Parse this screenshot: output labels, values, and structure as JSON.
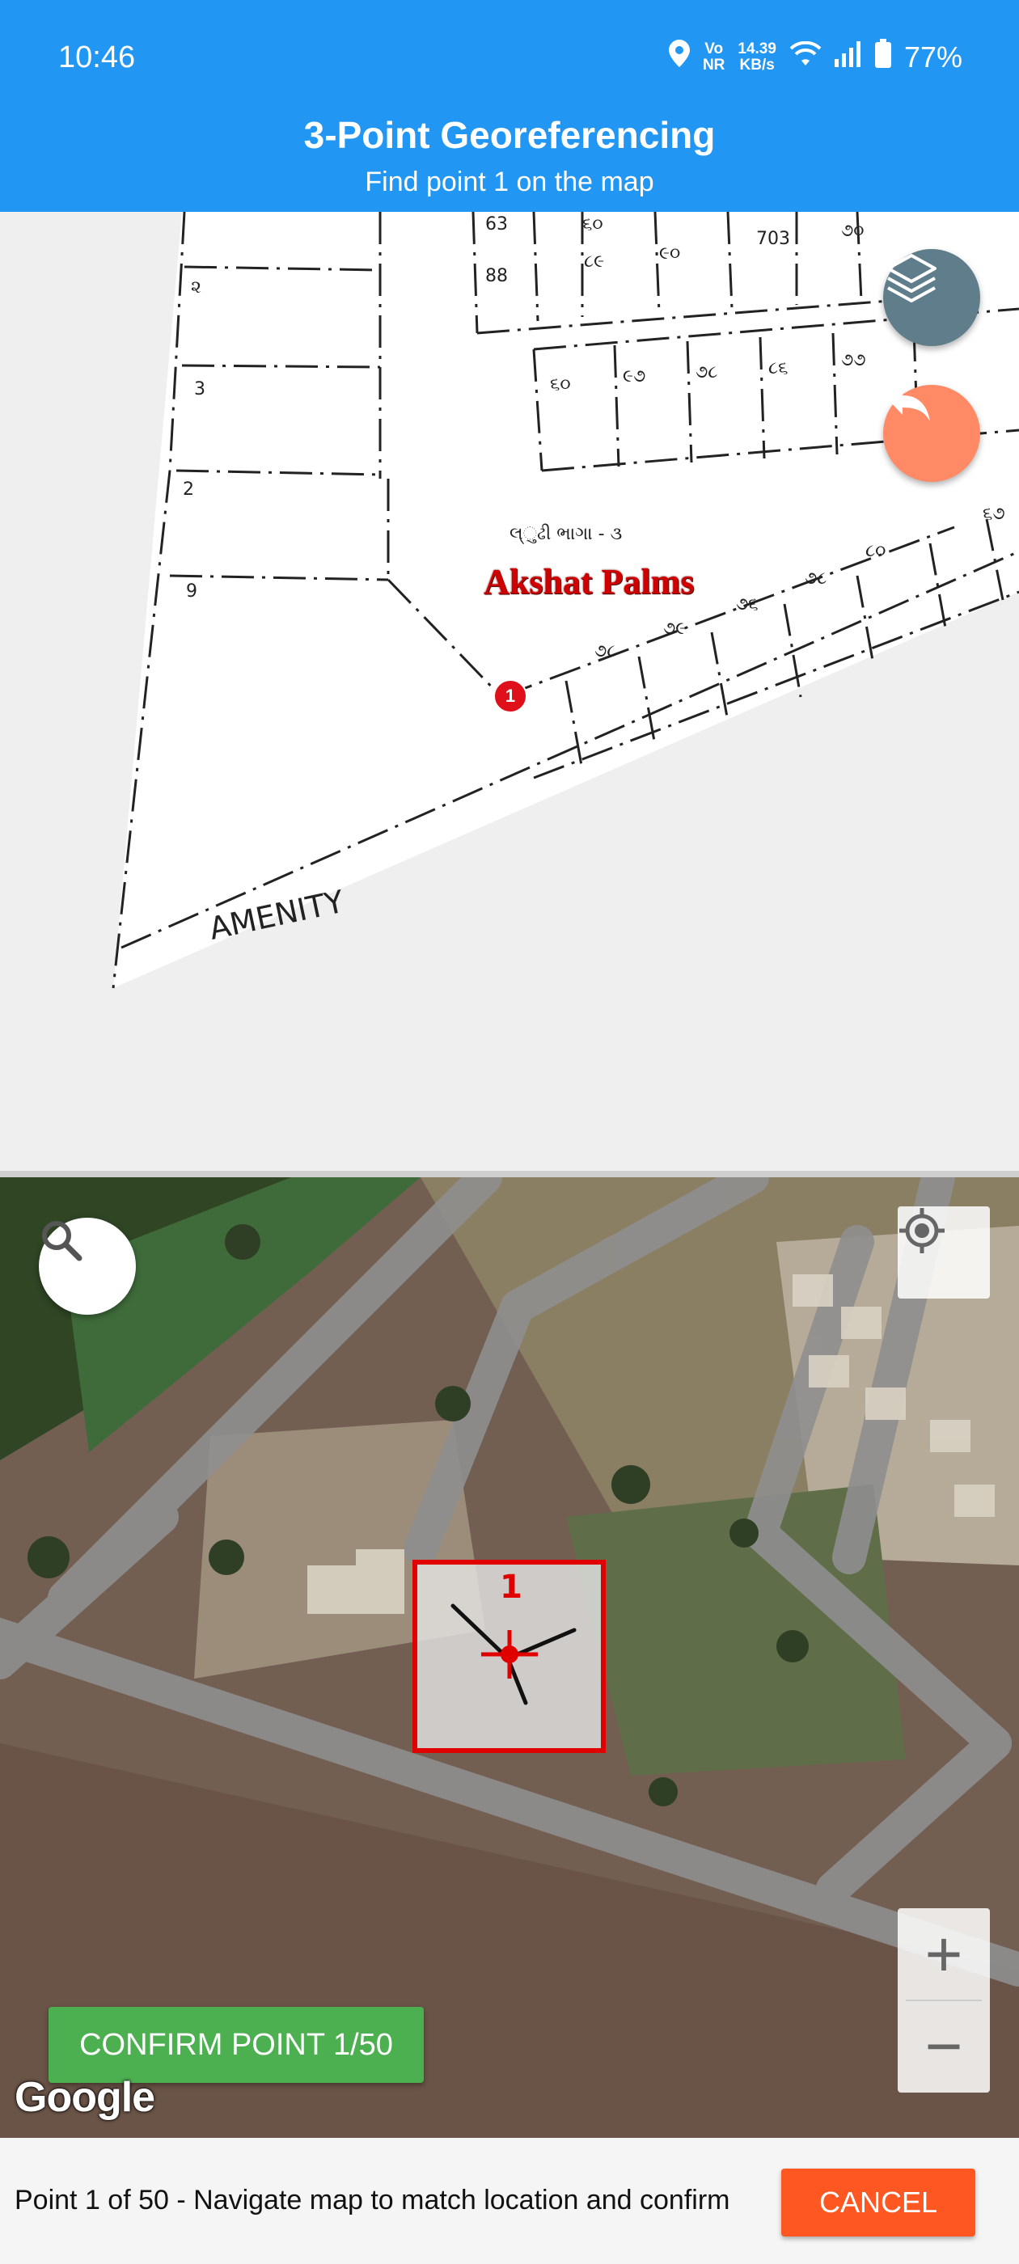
{
  "status": {
    "time": "10:46",
    "net_top": "Vo",
    "net_bottom": "NR",
    "speed_top": "14.39",
    "speed_bottom": "KB/s",
    "battery": "77%"
  },
  "header": {
    "title": "3-Point Georeferencing",
    "subtitle": "Find point 1 on the map"
  },
  "plan": {
    "label": "Akshat Palms",
    "amenity_text": "AMENITY",
    "marker_number": "1"
  },
  "plan_buttons": {
    "layers_icon": "layers-icon",
    "undo_icon": "undo-icon"
  },
  "map": {
    "search_icon": "search-icon",
    "locate_icon": "my-location-icon",
    "zoom_in": "+",
    "zoom_out": "−",
    "target_number": "1",
    "confirm_label": "CONFIRM POINT 1/50",
    "attribution": "Google"
  },
  "footer": {
    "instructions": "Point 1 of 50 - Navigate map to match location and confirm",
    "cancel_label": "CANCEL"
  },
  "colors": {
    "header": "#2196f3",
    "confirm": "#4caf50",
    "cancel": "#ff5722",
    "layers_fab": "#607d8b",
    "undo_fab": "#ff8a65",
    "marker": "#e0101b"
  }
}
